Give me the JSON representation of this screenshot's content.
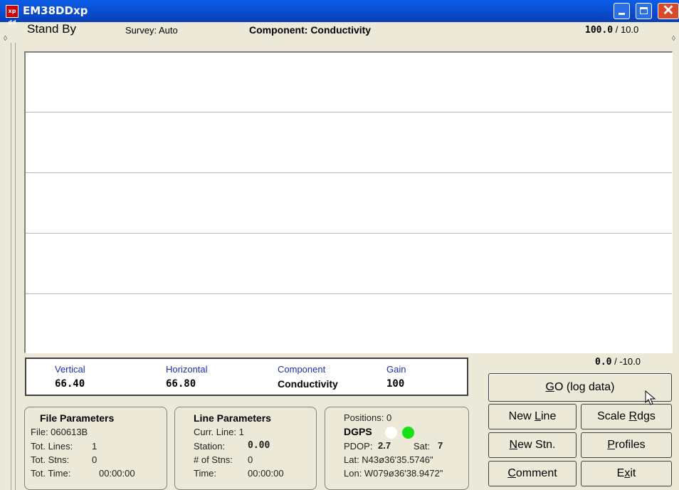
{
  "window": {
    "title": "EM38DDxp",
    "icon_text": "xp dd"
  },
  "status": {
    "mode": "Stand By",
    "survey": "Survey: Auto",
    "component": "Component: Conductivity",
    "scale_top_value": "100.0",
    "scale_top_sep": " / 10.0",
    "scale_bottom_value": "0.0",
    "scale_bottom_sep": " / -10.0"
  },
  "readings": {
    "vertical": {
      "label": "Vertical",
      "value": "66.40"
    },
    "horizontal": {
      "label": "Horizontal",
      "value": "66.80"
    },
    "component": {
      "label": "Component",
      "value": "Conductivity"
    },
    "gain": {
      "label": "Gain",
      "value": "100"
    }
  },
  "file_params": {
    "title": "File Parameters",
    "file": "File: 060613B",
    "tot_lines_label": "Tot. Lines:",
    "tot_lines": "1",
    "tot_stns_label": "Tot. Stns:",
    "tot_stns": "0",
    "tot_time_label": "Tot. Time:",
    "tot_time": "00:00:00"
  },
  "line_params": {
    "title": "Line Parameters",
    "curr_line": "Curr. Line: 1",
    "station_label": "Station:",
    "station": "0.00",
    "num_stns_label": "# of Stns:",
    "num_stns": "0",
    "time_label": "Time:",
    "time": "00:00:00"
  },
  "gps": {
    "positions": "Positions: 0",
    "dgps": "DGPS",
    "pdop_label": "PDOP:",
    "pdop": "2.7",
    "sat_label": "Sat:",
    "sat": "7",
    "lat": "Lat: N43ø36'35.5746\"",
    "lon": "Lon: W079ø36'38.9472\"",
    "indicator_1_color": "#ffffff",
    "indicator_2_color": "#16e016"
  },
  "buttons": {
    "go": "GO (log data)",
    "new_line": "New Line",
    "scale_rdgs": "Scale Rdgs",
    "new_stn": "New Stn.",
    "profiles": "Profiles",
    "comment": "Comment",
    "exit": "Exit"
  }
}
